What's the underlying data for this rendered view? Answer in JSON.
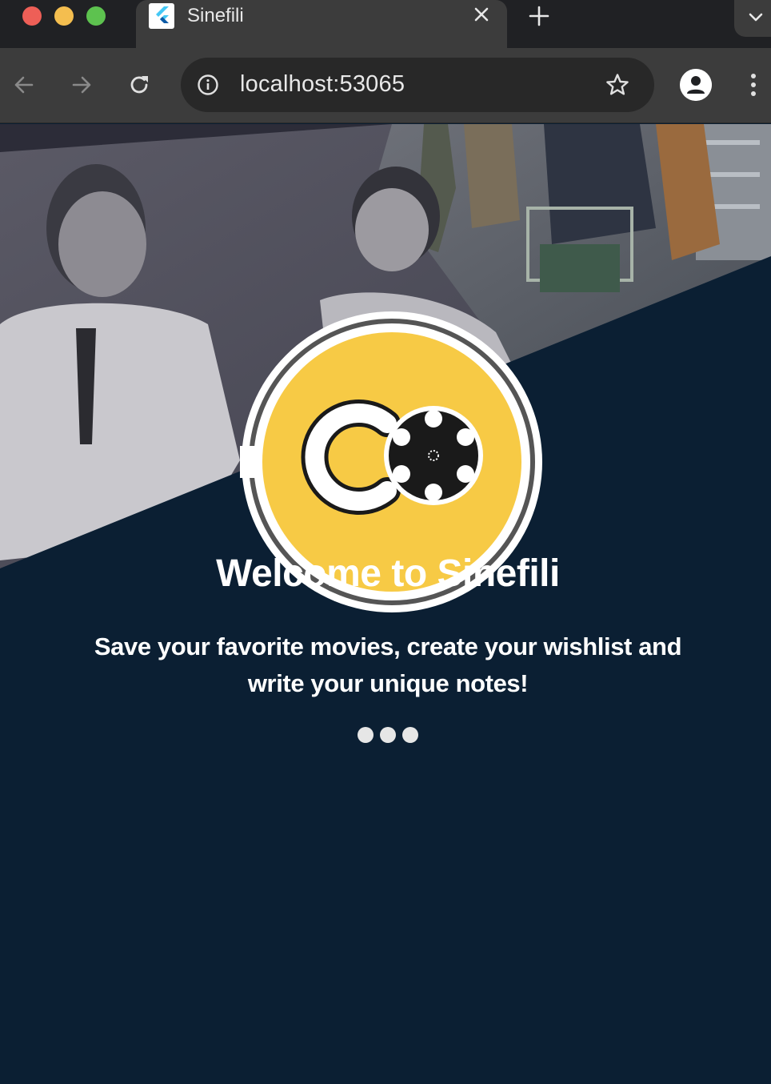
{
  "browser": {
    "tab_title": "Sinefili",
    "url": "localhost:53065"
  },
  "page": {
    "welcome_title": "Welcome to Sinefili",
    "subtitle": "Save your favorite movies, create your wishlist and write your unique notes!",
    "loading_dots": 3
  },
  "colors": {
    "page_background": "#0b1f33",
    "logo_yellow": "#f7ca45",
    "chrome_dark": "#202124",
    "chrome_toolbar": "#3c3c3c"
  },
  "icons": {
    "tab_favicon": "flutter-icon",
    "tab_close": "close-icon",
    "new_tab": "plus-icon",
    "tab_search": "chevron-down-icon",
    "back": "arrow-left-icon",
    "forward": "arrow-right-icon",
    "reload": "reload-icon",
    "site_info": "info-icon",
    "bookmark": "star-icon",
    "profile": "person-icon",
    "menu": "kebab-menu-icon",
    "app_logo": "film-reel-logo"
  }
}
